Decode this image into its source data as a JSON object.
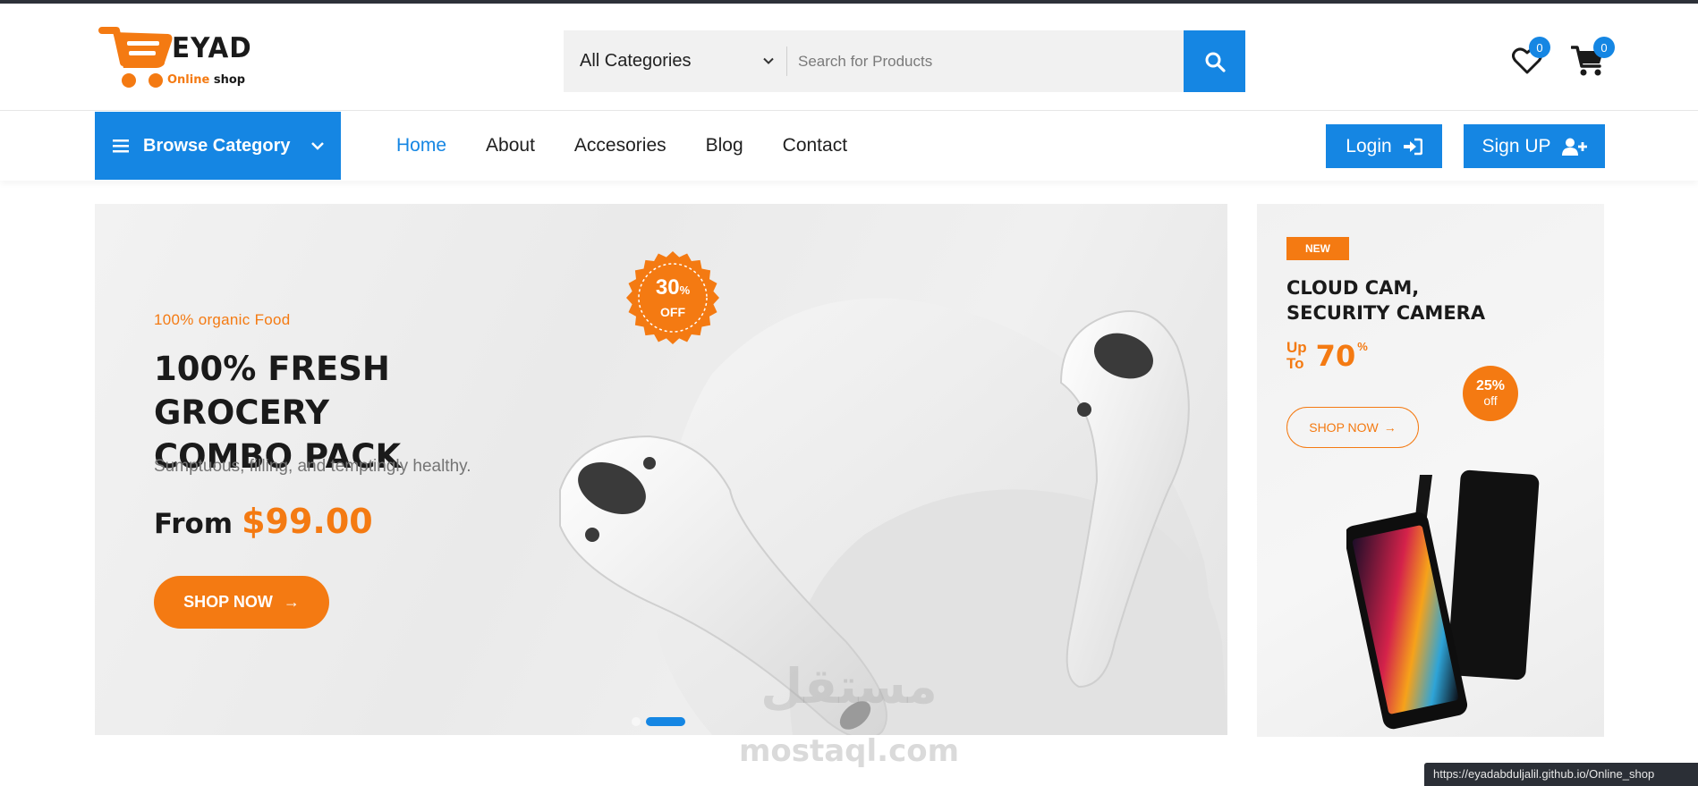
{
  "brand": {
    "name": "EYAD",
    "subtitle_part1": "Online",
    "subtitle_part2": "shop",
    "logo_icon": "shopping-cart-icon",
    "accent_color": "#f47a12",
    "primary_color": "#1586e3"
  },
  "search": {
    "category_selected": "All Categories",
    "placeholder": "Search for Products",
    "icon": "search-icon"
  },
  "header_icons": {
    "wishlist_count": "0",
    "cart_count": "0"
  },
  "nav": {
    "browse_label": "Browse Category",
    "links": [
      "Home",
      "About",
      "Accesories",
      "Blog",
      "Contact"
    ],
    "active": "Home",
    "login_label": "Login",
    "signup_label": "Sign UP"
  },
  "hero": {
    "tag": "100% organic Food",
    "title_line1": "100% FRESH GROCERY",
    "title_line2": "COMBO PACK",
    "description": "Sumptuous, filling, and temptingly healthy.",
    "from_label": "From",
    "price": "$99.00",
    "button_label": "SHOP NOW",
    "seal_percent": "30",
    "seal_percent_sign": "%",
    "seal_off": "OFF",
    "slides_active": 2,
    "slides_total": 2
  },
  "promo": {
    "badge": "NEW",
    "title_line1": "CLOUD CAM,",
    "title_line2": "SECURITY CAMERA",
    "up_label": "Up",
    "to_label": "To",
    "discount_value": "70",
    "discount_sign": "%",
    "circle_value": "25%",
    "circle_label": "off",
    "button_label": "SHOP NOW"
  },
  "watermark": {
    "arabic": "مستقل",
    "latin": "mostaql.com"
  },
  "status_url": "https://eyadabduljalil.github.io/Online_shop"
}
